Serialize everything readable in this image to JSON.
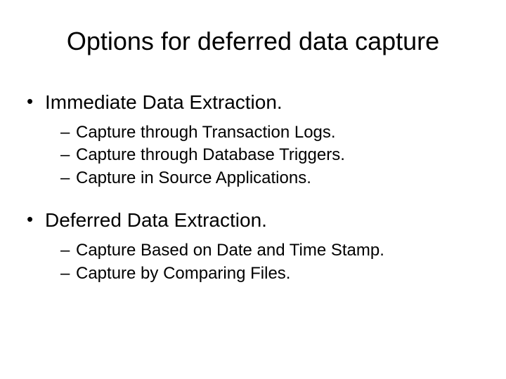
{
  "title": "Options for deferred data capture",
  "sections": [
    {
      "heading": "Immediate Data Extraction.",
      "items": [
        "Capture through Transaction Logs.",
        " Capture through Database Triggers.",
        "Capture in Source Applications."
      ]
    },
    {
      "heading": "Deferred Data Extraction.",
      "items": [
        "Capture Based on Date and Time Stamp.",
        "Capture by Comparing Files."
      ]
    }
  ]
}
